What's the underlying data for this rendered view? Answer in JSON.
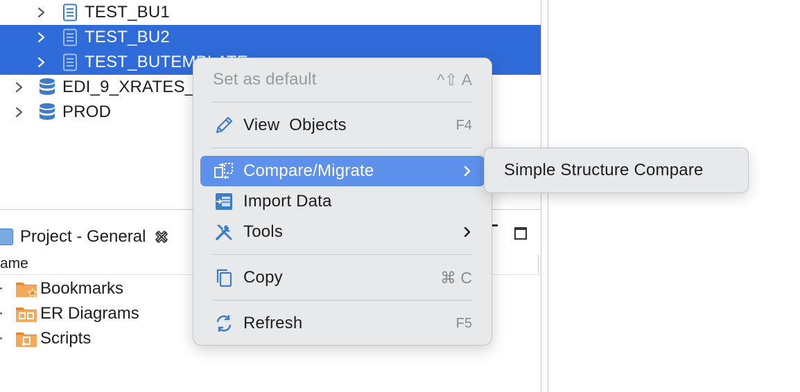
{
  "navigator": {
    "items": [
      {
        "label": "TEST_BU1",
        "type": "schema",
        "selected": false
      },
      {
        "label": "TEST_BU2",
        "type": "schema",
        "selected": true
      },
      {
        "label": "TEST_BUTEMPLATE",
        "type": "schema",
        "selected": true
      },
      {
        "label": "EDI_9_XRATES_",
        "type": "database",
        "selected": false
      },
      {
        "label": "PROD",
        "type": "database",
        "selected": false
      }
    ]
  },
  "project_panel": {
    "title": "Project - General",
    "column_header": "ame",
    "items": [
      {
        "label": "Bookmarks",
        "icon": "bookmarks-folder-icon"
      },
      {
        "label": "ER Diagrams",
        "icon": "er-diagrams-folder-icon"
      },
      {
        "label": "Scripts",
        "icon": "scripts-folder-icon"
      }
    ]
  },
  "context_menu": {
    "set_default": {
      "label": "Set as default",
      "shortcut": "^⇧ A",
      "enabled": false
    },
    "view_objects": {
      "label": "View  Objects",
      "shortcut": "F4"
    },
    "compare_migrate": {
      "label": "Compare/Migrate",
      "highlighted": true
    },
    "import_data": {
      "label": "Import Data"
    },
    "tools": {
      "label": "Tools"
    },
    "copy": {
      "label": "Copy",
      "shortcut": "⌘ C"
    },
    "refresh": {
      "label": "Refresh",
      "shortcut": "F5"
    }
  },
  "submenu": {
    "items": [
      {
        "label": "Simple Structure Compare"
      }
    ]
  },
  "colors": {
    "selection": "#2f6bd9",
    "menu_highlight": "#5d91ec",
    "menu_background": "#e8e9ea",
    "folder_orange": "#e8892f",
    "db_blue": "#3d7cc9"
  }
}
